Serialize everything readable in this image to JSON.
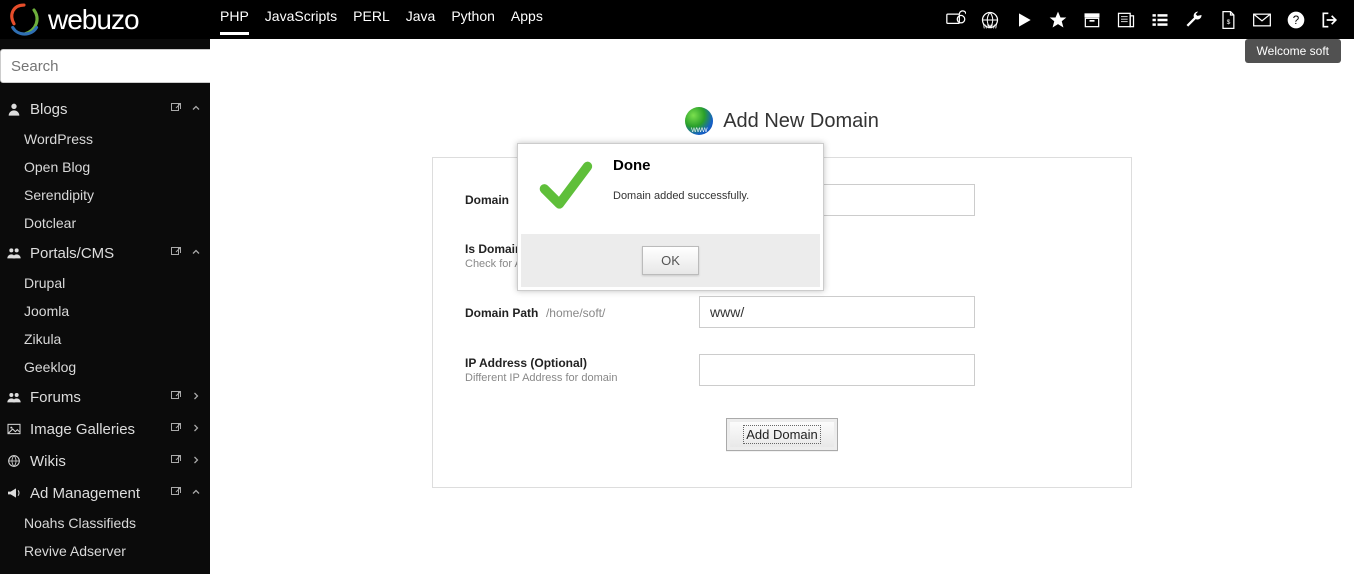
{
  "brand": {
    "name": "webuzo"
  },
  "topnav": {
    "items": [
      "PHP",
      "JavaScripts",
      "PERL",
      "Java",
      "Python",
      "Apps"
    ],
    "active_index": 0
  },
  "welcome_text": "Welcome soft",
  "search": {
    "placeholder": "Search"
  },
  "sidebar": {
    "categories": [
      {
        "label": "Blogs",
        "expanded": true,
        "items": [
          "WordPress",
          "Open Blog",
          "Serendipity",
          "Dotclear"
        ]
      },
      {
        "label": "Portals/CMS",
        "expanded": true,
        "items": [
          "Drupal",
          "Joomla",
          "Zikula",
          "Geeklog"
        ]
      },
      {
        "label": "Forums",
        "expanded": false,
        "items": []
      },
      {
        "label": "Image Galleries",
        "expanded": false,
        "items": []
      },
      {
        "label": "Wikis",
        "expanded": false,
        "items": []
      },
      {
        "label": "Ad Management",
        "expanded": true,
        "items": [
          "Noahs Classifieds",
          "Revive Adserver"
        ]
      }
    ]
  },
  "page": {
    "title": "Add New Domain",
    "fields": {
      "domain": {
        "label": "Domain",
        "value": ""
      },
      "addon": {
        "label": "Is Domain Addon ?",
        "hint": "Check for Addon Domain"
      },
      "path": {
        "label": "Domain Path",
        "prefix": "/home/soft/",
        "value": "www/"
      },
      "ip": {
        "label": "IP Address (Optional)",
        "hint": "Different IP Address for domain",
        "value": ""
      }
    },
    "submit_label": "Add Domain"
  },
  "modal": {
    "title": "Done",
    "message": "Domain added successfully.",
    "ok_label": "OK"
  }
}
